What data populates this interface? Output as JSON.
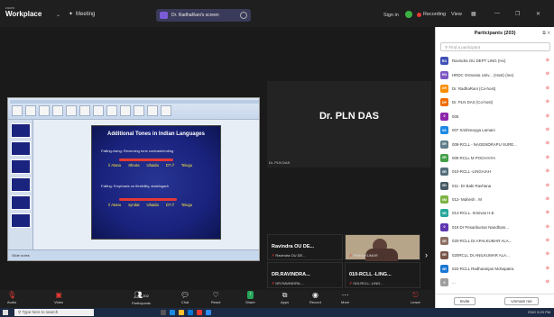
{
  "topbar": {
    "brand_small": "zoom",
    "brand": "Workplace",
    "meeting_label": "Meeting",
    "share_label": "Dr. RadhaRani's screen",
    "sign_in": "Sign in",
    "recording": "Recording",
    "view": "View"
  },
  "slide": {
    "title": "Additional Tones in Indian Languages",
    "bullet1": "Falling-rising: Reversing tone contrast/ending",
    "row1": [
      "// Atanu",
      "Shruta",
      "Ubaida",
      "DT //",
      "Telugu"
    ],
    "bullet2": "Falling: Emphasis on flexibility, statelogarh",
    "row2": [
      "// Atanu",
      "syndat",
      "Ubaida",
      "DT //",
      "Telugu"
    ],
    "status": "Slide notes"
  },
  "speaker": {
    "name": "Dr. PLN DAS",
    "label": "Dr. PLN DAS"
  },
  "tiles": [
    {
      "name": "Ravindra OU DE...",
      "sub": "Ravindra OU DE..."
    },
    {
      "name": "",
      "sub": "SINKA KUMAR"
    },
    {
      "name": "DR.RAVINDRA...",
      "sub": "DR.RAVINDRA ..."
    },
    {
      "name": "010-RCLL -LING...",
      "sub": "010-RCLL -LING..."
    }
  ],
  "toolbar": {
    "audio": "Audio",
    "video": "Video",
    "participants": "Participants",
    "participants_count": "202",
    "chat": "Chat",
    "react": "React",
    "share": "Share",
    "apps": "Apps",
    "record": "Record",
    "more": "More",
    "leave": "Leave"
  },
  "panel": {
    "title": "Participants (203)",
    "find_placeholder": "Find a participant",
    "participants": [
      {
        "initials": "RO",
        "color": "#3f51b5",
        "name": "Ravindra OU DEPT LING (Ho)"
      },
      {
        "initials": "HU",
        "color": "#7e57c2",
        "name": "HRDC Osmania Univ... (Host) (me)"
      },
      {
        "initials": "DR",
        "color": "#fb8c00",
        "name": "Dr. RadhaRani (Co-host)"
      },
      {
        "initials": "DP",
        "color": "#ef6c00",
        "name": "Dr. PLN DAS (Co-host)"
      },
      {
        "initials": "0",
        "color": "#8e24aa",
        "name": "005"
      },
      {
        "initials": "0S",
        "color": "#1e88e5",
        "name": "007 Srishreeyga Lamani"
      },
      {
        "initials": "0R",
        "color": "#607d8b",
        "name": "008-RCLL - NAGENDRAPU SURE..."
      },
      {
        "initials": "0R",
        "color": "#43a047",
        "name": "009 RCLL M POCHAIYA"
      },
      {
        "initials": "0R",
        "color": "#546e7a",
        "name": "010-RCLL -LINGAIAH"
      },
      {
        "initials": "0D",
        "color": "#455a64",
        "name": "011- Dr Babi Ravhana"
      },
      {
        "initials": "0M",
        "color": "#7cb342",
        "name": "012- Mahesh . M"
      },
      {
        "initials": "0R",
        "color": "#26a69a",
        "name": "014-RCLL. Srinivas H.E"
      },
      {
        "initials": "0",
        "color": "#5e35b1",
        "name": "019 Dr Pesarikumar Nandham..."
      },
      {
        "initials": "0R",
        "color": "#8d6e63",
        "name": "020-RCLL Dr.APALKUMAR ALA..."
      },
      {
        "initials": "0R",
        "color": "#795548",
        "name": "020RCLL Dr.ANILKUMAR ALA..."
      },
      {
        "initials": "0R",
        "color": "#1976d2",
        "name": "022-RCLL Radharanjan Mohapatra"
      },
      {
        "initials": "0",
        "color": "#9e9e9e",
        "name": "..."
      }
    ],
    "invite": "Invite",
    "unmute_me": "Unmute me"
  },
  "taskbar": {
    "search_placeholder": "Type here to search",
    "lang": "ENG",
    "time": "9:29 PM"
  }
}
